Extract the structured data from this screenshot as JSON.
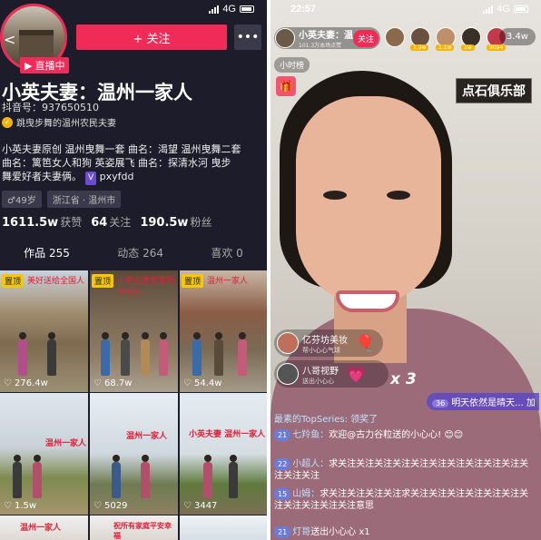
{
  "left": {
    "status_time": "",
    "status_network": "4G",
    "live_tag": "直播中",
    "follow_label": "+ 关注",
    "more_label": "•••",
    "name": "小英夫妻：温州一家人",
    "douyin_id": "抖音号：937650510",
    "verify_text": "跳曳步舞的温州农民夫妻",
    "bio_line1": "小英夫妻原创 温州曳舞一套 曲名：渴望 温州曳舞二套",
    "bio_line2": "曲名：篱笆女人和狗 英姿展飞 曲名：探清水河 曳步",
    "bio_line3": "舞爱好者夫妻俩。",
    "bio_wechat": "pxyfdd",
    "tag_age": "♂49岁",
    "tag_location": "浙江省 · 温州市",
    "stats": [
      {
        "value": "1611.5w",
        "label": "获赞"
      },
      {
        "value": "64",
        "label": "关注"
      },
      {
        "value": "190.5w",
        "label": "粉丝"
      }
    ],
    "tabs": [
      "作品 255",
      "动态 264",
      "喜欢 0"
    ],
    "videos": [
      {
        "pin": "置顶",
        "caption": "美好送给全国人",
        "likes": "276.4w"
      },
      {
        "pin": "置顶",
        "caption": "小英夫妻老家新年快乐",
        "likes": "68.7w"
      },
      {
        "pin": "置顶",
        "caption": "温州一家人",
        "likes": "54.4w"
      },
      {
        "pin": "",
        "caption": "温州一家人",
        "likes": "1.5w"
      },
      {
        "pin": "",
        "caption": "温州一家人",
        "likes": "5029"
      },
      {
        "pin": "",
        "caption": "小英夫妻 温州一家人",
        "likes": "3447"
      },
      {
        "pin": "",
        "caption": "温州一家人",
        "likes": ""
      },
      {
        "pin": "",
        "caption": "祝所有家庭平安幸福",
        "likes": ""
      },
      {
        "pin": "",
        "caption": "",
        "likes": ""
      }
    ]
  },
  "right": {
    "status_time": "22:57",
    "status_network": "4G",
    "host_name": "小英夫妻：温...",
    "host_sub": "101.3万本场点赞",
    "host_follow": "关注",
    "viewer_badges": [
      "",
      "1.9w",
      "1.1w",
      "1w",
      "9094"
    ],
    "viewer_count": "3.4w",
    "rank_label": "小时榜",
    "club_label": "点石俱乐部",
    "gift1_name": "亿芬坊美妆",
    "gift1_sub": "帮小心心气球",
    "gift2_name": "八哥视野",
    "gift2_sub": "送出小心心",
    "gift2_count": "x 3",
    "notice_badge": "36",
    "notice_text": "明天依然是晴天... 加",
    "messages": [
      {
        "lv": "",
        "name": "",
        "text": "最素的TopSeries: 领奖了"
      },
      {
        "lv": "21",
        "name": "七羚鱼：",
        "text": "欢迎@古力谷粒送的小心心! 😊😊"
      },
      {
        "lv": "22",
        "name": "小超人：",
        "text": "求关注关注关注关注关注关注关注关注关注关注关注关注关注"
      },
      {
        "lv": "15",
        "name": "山姆：",
        "text": "求关注关注关注关注求关注关注关注关注关注关注关注关注关注关注关注意思"
      },
      {
        "lv": "21",
        "name": "灯哥",
        "text": "送出小心心 x1"
      }
    ]
  }
}
